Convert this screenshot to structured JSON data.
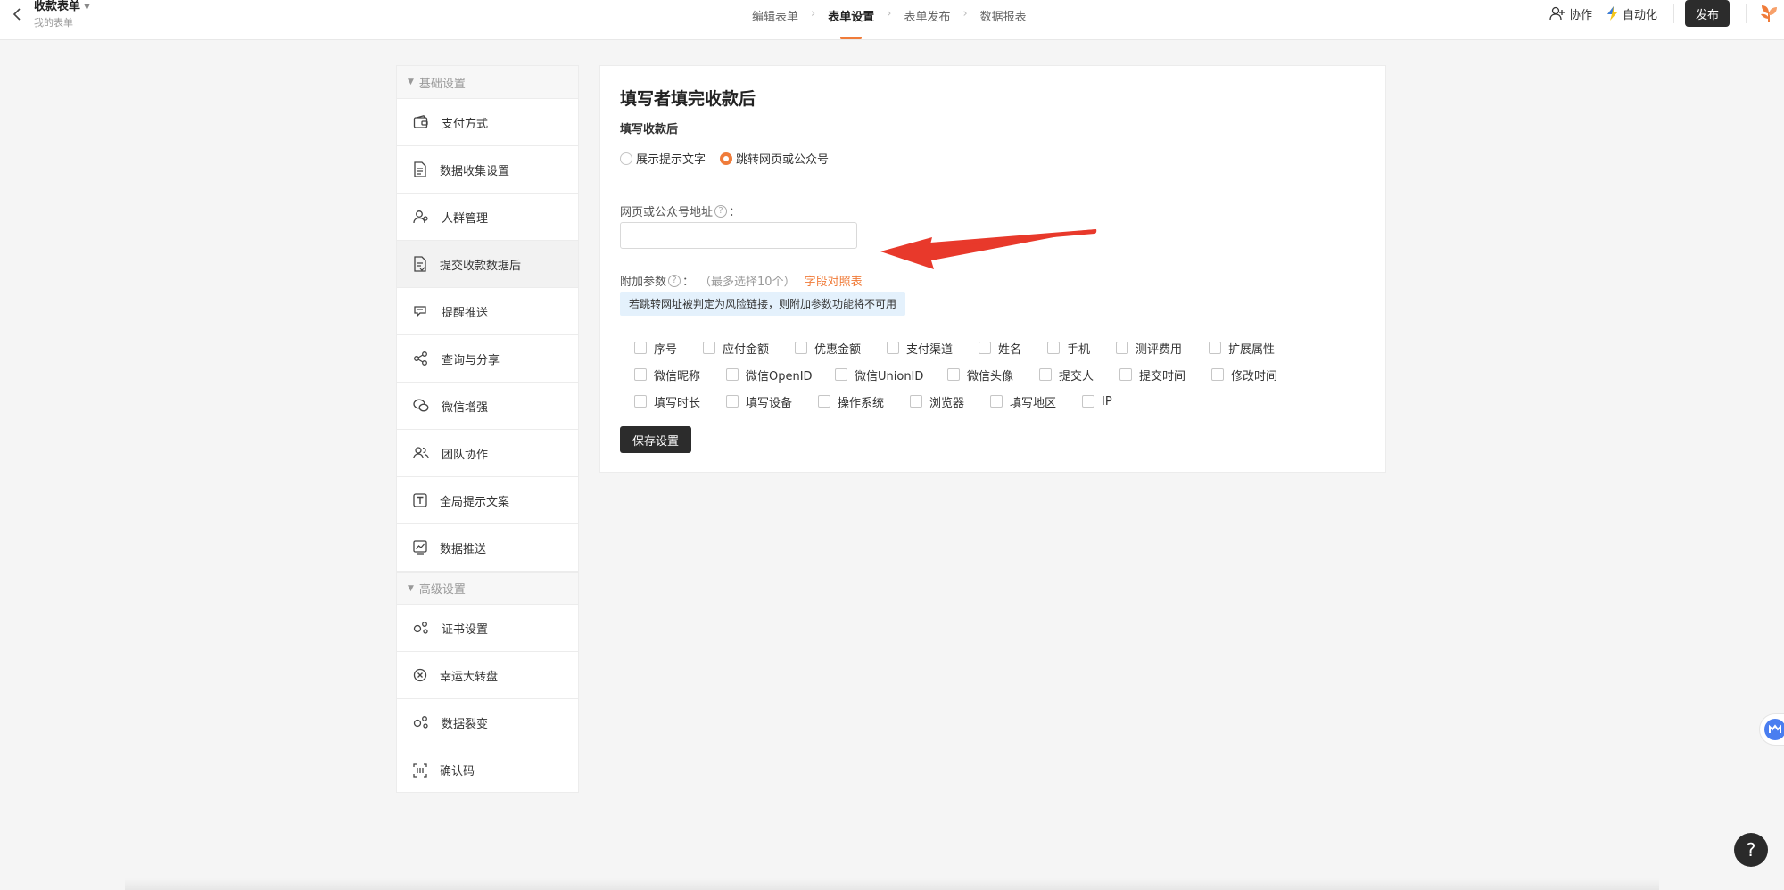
{
  "header": {
    "form_title": "收款表单",
    "form_subtitle": "我的表单",
    "steps": [
      {
        "label": "编辑表单",
        "active": false
      },
      {
        "label": "表单设置",
        "active": true
      },
      {
        "label": "表单发布",
        "active": false
      },
      {
        "label": "数据报表",
        "active": false
      }
    ],
    "collab_label": "协作",
    "auto_label": "自动化",
    "publish_label": "发布"
  },
  "sidebar": {
    "basic_group": "基础设置",
    "basic_items": [
      {
        "label": "支付方式",
        "icon": "wallet-icon"
      },
      {
        "label": "数据收集设置",
        "icon": "document-icon"
      },
      {
        "label": "人群管理",
        "icon": "user-group-icon"
      },
      {
        "label": "提交收款数据后",
        "icon": "submit-doc-icon",
        "active": true
      },
      {
        "label": "提醒推送",
        "icon": "notification-icon"
      },
      {
        "label": "查询与分享",
        "icon": "share-icon"
      },
      {
        "label": "微信增强",
        "icon": "wechat-icon"
      },
      {
        "label": "团队协作",
        "icon": "team-icon"
      },
      {
        "label": "全局提示文案",
        "icon": "text-icon"
      },
      {
        "label": "数据推送",
        "icon": "chart-push-icon"
      }
    ],
    "advanced_group": "高级设置",
    "advanced_items": [
      {
        "label": "证书设置",
        "icon": "certificate-icon"
      },
      {
        "label": "幸运大转盘",
        "icon": "wheel-icon"
      },
      {
        "label": "数据裂变",
        "icon": "fission-icon"
      },
      {
        "label": "确认码",
        "icon": "barcode-icon"
      }
    ]
  },
  "panel": {
    "title": "填写者填完收款后",
    "section_label": "填写收款后",
    "radio_options": [
      {
        "label": "展示提示文字",
        "checked": false
      },
      {
        "label": "跳转网页或公众号",
        "checked": true
      }
    ],
    "url_label": "网页或公众号地址",
    "url_colon": "：",
    "url_value": "",
    "extra_label": "附加参数",
    "extra_colon": "：",
    "extra_hint": "（最多选择10个）",
    "field_map_link": "字段对照表",
    "warning": "若跳转网址被判定为风险链接，则附加参数功能将不可用",
    "params": [
      [
        "序号",
        "应付金额",
        "优惠金额",
        "支付渠道",
        "姓名",
        "手机",
        "测评费用",
        "扩展属性"
      ],
      [
        "微信昵称",
        "微信OpenID",
        "微信UnionID",
        "微信头像",
        "提交人",
        "提交时间",
        "修改时间"
      ],
      [
        "填写时长",
        "填写设备",
        "操作系统",
        "浏览器",
        "填写地区",
        "IP"
      ]
    ],
    "save_label": "保存设置"
  },
  "floating": {
    "help_label": "?"
  },
  "colors": {
    "accent": "#f07c3a",
    "dark_button": "#2c2c2c",
    "annotation_arrow": "#e8392b",
    "warning_bg": "#e4f1fc"
  }
}
